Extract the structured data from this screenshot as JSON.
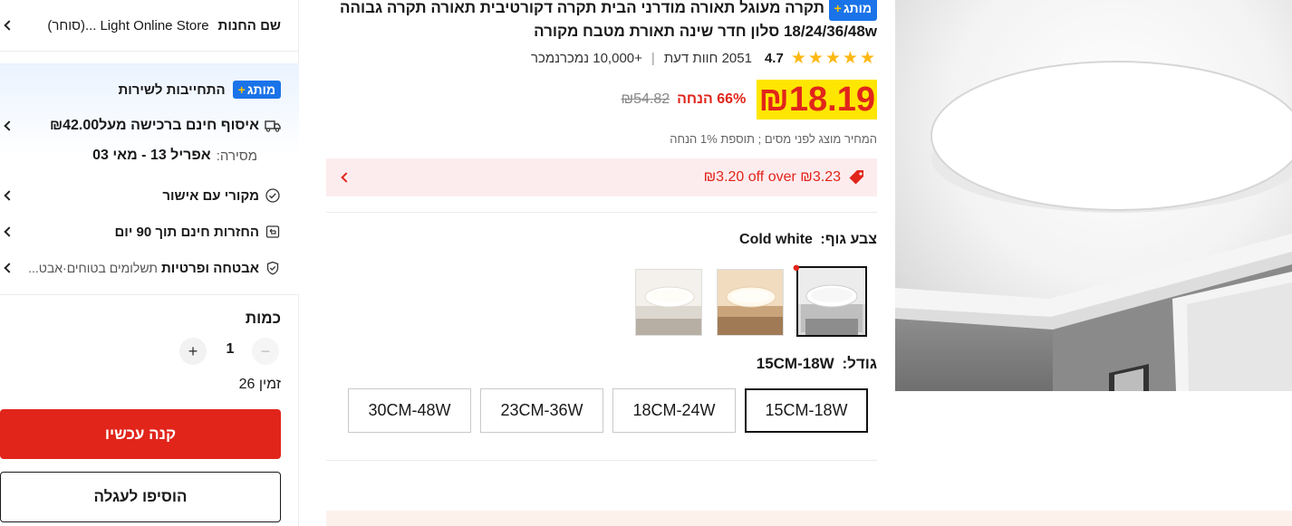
{
  "store": {
    "label": "שם החנות",
    "name": "Light Online Store",
    "suffix": "...(סוחר)"
  },
  "service": {
    "badge": "מותג",
    "title": "התחייבות לשירות",
    "delivery": "איסוף חינם ברכישה מעל₪42.00",
    "eta_label": "מסירה:",
    "eta_value": "אפריל 13 - מאי 03",
    "authentic": "מקורי עם אישור",
    "returns": "החזרות חינם תוך 90 יום",
    "security": "אבטחה ופרטיות",
    "security_sub": "תשלומים בטוחים·אבט..."
  },
  "quantity": {
    "label": "כמות",
    "value": "1",
    "stock": "26 זמין"
  },
  "actions": {
    "buy_now": "קנה עכשיו",
    "add_to_cart": "הוסיפו לעגלה"
  },
  "product": {
    "badge": "מותג",
    "title_line1": "תקרה מעוגל תאורה מודרני הבית תקרה דקורטיבית תאורה תקרה גבוהה",
    "title_line2": "18/24/36/48w סלון חדר שינה תאורת מטבח מקורה",
    "rating": "4.7",
    "reviews": "2051 חוות דעת",
    "sold": "+10,000 נמכרנמכר",
    "price": "₪18.19",
    "discount": "66% הנחה",
    "original_price": "₪54.82",
    "tax_note": "המחיר מוצג לפני מסים ; תוספת 1% הנחה",
    "coupon": "₪3.20 off over ₪3.23",
    "color_label": "צבע גוף:",
    "color_value": "Cold white",
    "size_label": "גודל:",
    "size_value": "15CM-18W",
    "sizes": [
      "15CM-18W",
      "18CM-24W",
      "23CM-36W",
      "30CM-48W"
    ]
  },
  "colors": {
    "accent_red": "#e1251b",
    "price_yellow": "#ffe600",
    "coupon_bg": "#fdecee",
    "choice_blue": "#1a73e8",
    "star": "#fdb813"
  }
}
